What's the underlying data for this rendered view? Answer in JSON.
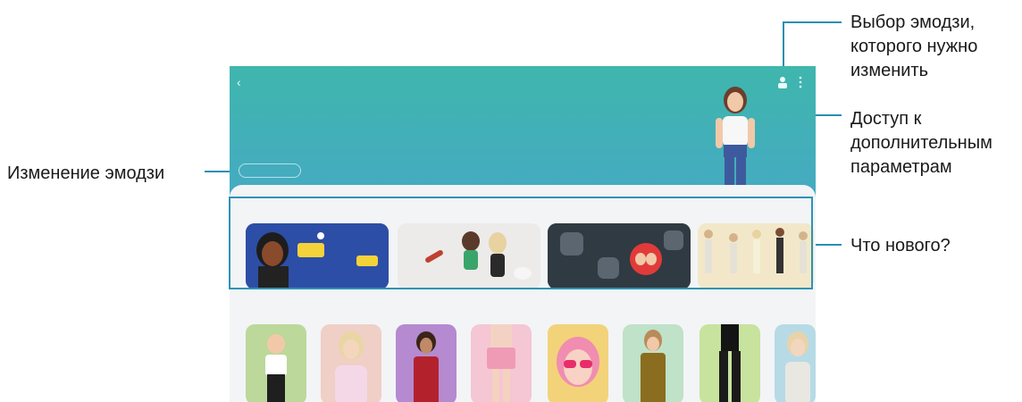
{
  "callouts": {
    "select_emoji": "Выбор эмодзи,\nкоторого нужно\nизменить",
    "more_options": "Доступ к\nдополнительным\nпараметрам",
    "edit_emoji": "Изменение эмодзи",
    "whats_new": "Что нового?"
  },
  "screen": {
    "back_icon": "chevron-left-icon",
    "avatar_icon": "person-icon",
    "more_icon": "more-vertical-icon"
  },
  "colors": {
    "accent": "#2e93b6",
    "hero_top": "#3fb6ad",
    "hero_bottom": "#46a9c4"
  }
}
